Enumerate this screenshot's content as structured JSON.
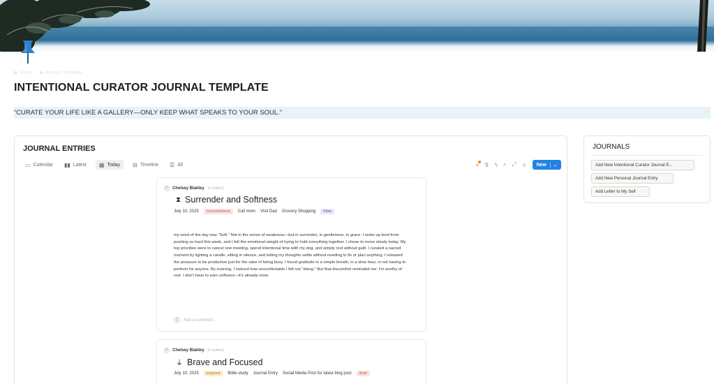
{
  "breadcrumb": [
    "Home",
    "Journal Template"
  ],
  "page": {
    "title": "INTENTIONAL CURATOR JOURNAL TEMPLATE",
    "quote": "“CURATE YOUR LIFE LIKE A GALLERY—ONLY KEEP WHAT SPEAKS TO YOUR SOUL.”"
  },
  "database": {
    "title": "JOURNAL ENTRIES",
    "views": [
      {
        "label": "Calendar",
        "icon": "calendar-icon"
      },
      {
        "label": "Latest",
        "icon": "book-icon"
      },
      {
        "label": "Today",
        "icon": "gallery-icon",
        "active": true
      },
      {
        "label": "Timeline",
        "icon": "timeline-icon"
      },
      {
        "label": "All",
        "icon": "list-icon"
      }
    ],
    "new_label": "New"
  },
  "entries": [
    {
      "author": "Chelsey Blakley",
      "edited": "1h (edited)",
      "avatar": "C",
      "title": "Surrender and Softness",
      "date": "July 10, 2025",
      "mood": "Overwhelmed",
      "todos": [
        "Call mom",
        "Visit Dad",
        "Grocery Shopping"
      ],
      "energy": "Flow",
      "body": "my word of the day was \"Soft.\" Not in the sense of weakness—but in surrender, in gentleness, in grace. I woke up tired from pushing so hard this week, and I felt the emotional weight of trying to hold everything together. I chose to move slowly today. My top priorities were to cancel one meeting, spend intentional time with my dog, and simply rest without guilt. I curated a sacred moment by lighting a candle, sitting in silence, and letting my thoughts settle without needing to fix or plan anything. I released the pressure to be productive just for the sake of being busy. I found gratitude in a simple breath, in a slow hour, in not having to perform for anyone. By evening, I noticed how uncomfortable I felt not \"doing.\" But that discomfort reminded me: I'm worthy of rest. I don't have to earn softness—it's already mine.",
      "comment_placeholder": "Add a comment..."
    },
    {
      "author": "Chelsey Blakley",
      "edited": "1h (edited)",
      "avatar": "C",
      "title": "Brave and Focused",
      "date": "July 10, 2025",
      "mood": "Inspired",
      "todos": [
        "Bible study",
        "Journal Entry",
        "Social Media Post for latest blog post"
      ],
      "energy": "Bold"
    }
  ],
  "journals": {
    "title": "JOURNALS",
    "buttons": [
      "Add New Intentional Curator Journal E...",
      "Add New Personal Journal Entry",
      "Add Letter to My Self"
    ]
  }
}
